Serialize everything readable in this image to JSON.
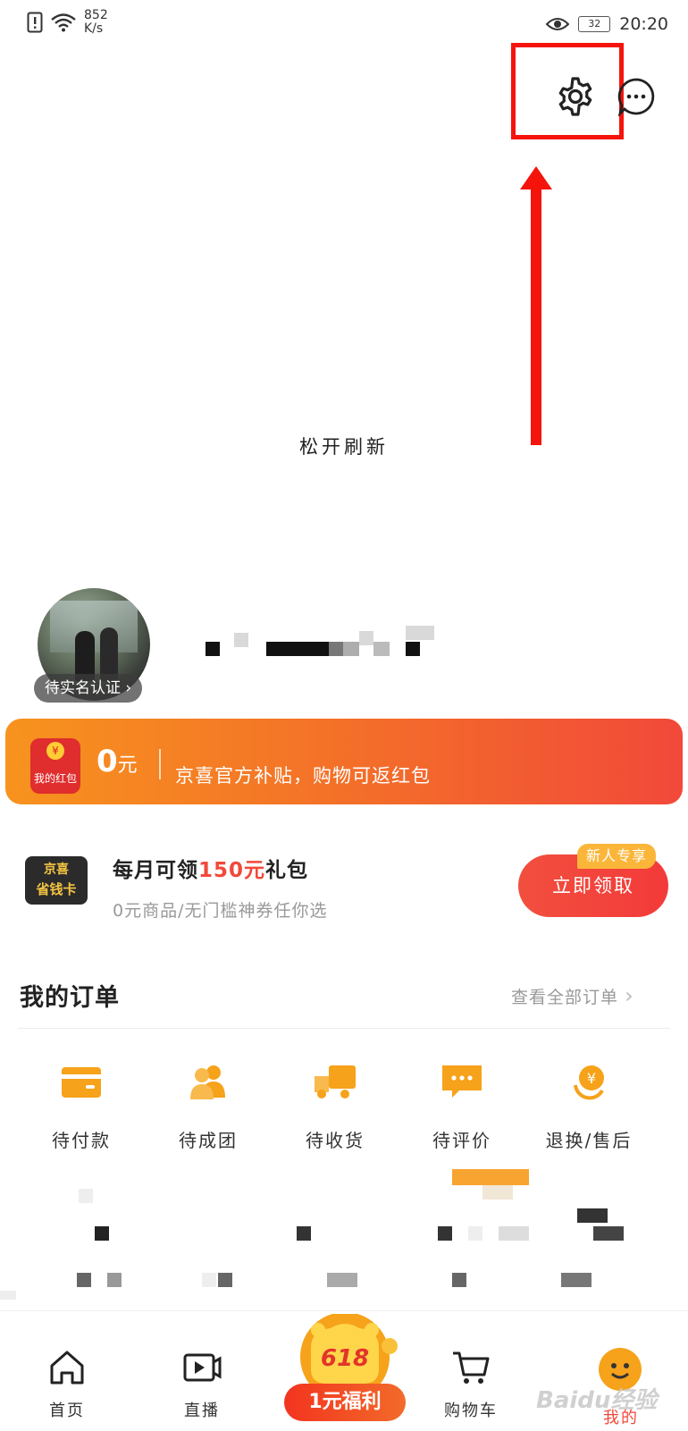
{
  "status_bar": {
    "speed_value": "852",
    "speed_unit": "K/s",
    "battery": "32",
    "time": "20:20"
  },
  "pull_to_refresh": {
    "text": "松开刷新"
  },
  "profile": {
    "verify_label": "待实名认证"
  },
  "red_packet": {
    "icon_label": "我的红包",
    "coin_symbol": "¥",
    "amount": "0",
    "unit": "元",
    "description": "京喜官方补贴，购物可返红包"
  },
  "savings_card": {
    "icon_line1": "京喜",
    "icon_line2": "省钱卡",
    "title_prefix": "每月可领",
    "title_highlight": "150元",
    "title_suffix": "礼包",
    "subtitle": "0元商品/无门槛神券任你选",
    "badge": "新人专享",
    "button": "立即领取"
  },
  "orders": {
    "title": "我的订单",
    "view_all": "查看全部订单",
    "items": [
      {
        "label": "待付款",
        "icon": "wallet-icon"
      },
      {
        "label": "待成团",
        "icon": "group-icon"
      },
      {
        "label": "待收货",
        "icon": "truck-icon"
      },
      {
        "label": "待评价",
        "icon": "comment-icon"
      },
      {
        "label": "退换/售后",
        "icon": "refund-icon"
      }
    ]
  },
  "tab_bar": {
    "items": [
      {
        "label": "首页",
        "icon": "home-icon"
      },
      {
        "label": "直播",
        "icon": "live-icon"
      },
      {
        "label": "购物车",
        "icon": "cart-icon"
      },
      {
        "label": "我的",
        "icon": "profile-icon"
      }
    ],
    "promo_badge": "1元福利",
    "promo_number": "618"
  },
  "watermark": "Baidu经验",
  "colors": {
    "accent_orange": "#f7931e",
    "accent_red": "#f2493a",
    "icon_orange": "#f6a21a",
    "annotation_red": "#f5140c"
  }
}
